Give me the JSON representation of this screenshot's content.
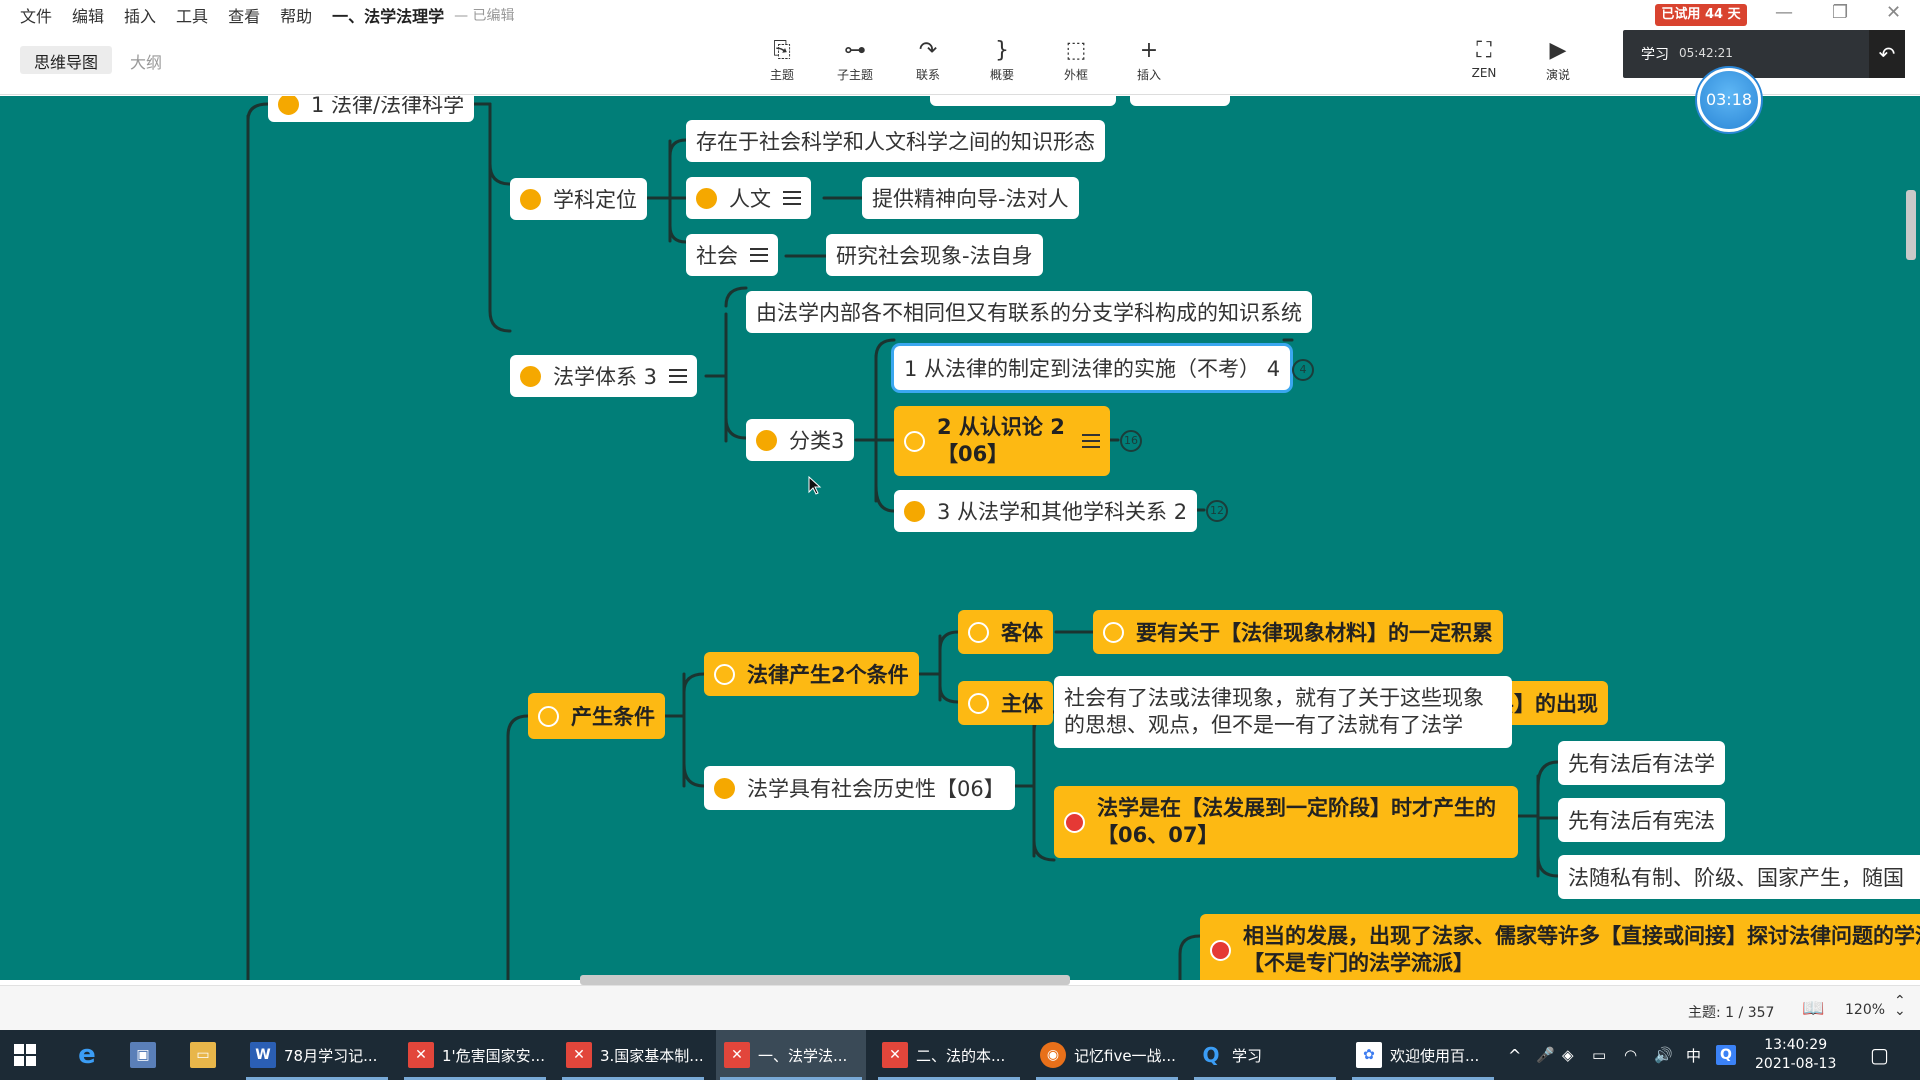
{
  "menubar": {
    "items": [
      "文件",
      "编辑",
      "插入",
      "工具",
      "查看",
      "帮助"
    ],
    "doc_title": "一、法学法理学",
    "doc_status": "— 已编辑",
    "badge": "已试用 44 天"
  },
  "toolbar": {
    "view_tabs": [
      "思维导图",
      "大纲"
    ],
    "tools": [
      {
        "label": "主题",
        "icon": "topic-icon"
      },
      {
        "label": "子主题",
        "icon": "subtopic-icon"
      },
      {
        "label": "联系",
        "icon": "relation-icon"
      },
      {
        "label": "概要",
        "icon": "summary-icon"
      },
      {
        "label": "外框",
        "icon": "boundary-icon"
      },
      {
        "label": "插入",
        "icon": "plus-icon"
      },
      {
        "label": "ZEN",
        "icon": "fullscreen-icon"
      },
      {
        "label": "演说",
        "icon": "present-icon"
      }
    ]
  },
  "timer": {
    "label": "学习",
    "time": "05:42:21",
    "countdown": "03:18"
  },
  "mindmap": {
    "nodes": {
      "n_root": "1 法律/法律科学",
      "n_xkdw": "学科定位",
      "n_zszj": "存在于社会科学和人文科学之间的知识形态",
      "n_renwen": "人文",
      "n_renwen_d": "提供精神向导-法对人",
      "n_shehui": "社会",
      "n_shehui_d": "研究社会现象-法自身",
      "n_fxtx": "法学体系 3",
      "n_fxtx_d": "由法学内部各不相同但又有联系的分支学科构成的知识系统",
      "n_fenlei": "分类3",
      "n_fl1": "1 从法律的制定到法律的实施（不考） 4",
      "n_fl2": "2 从认识论 2 【06】",
      "n_fl3": "3 从法学和其他学科关系 2",
      "n_cstj": "产生条件",
      "n_lvtj": "法律产生2个条件",
      "n_keti": "客体",
      "n_keti_d": "要有关于【法律现象材料】的一定积累",
      "n_zhuti": "主体",
      "n_zhuti_d": "要有专门从事研究法律现象的【学者阶层】的出现",
      "n_shls": "法学具有社会历史性【06】",
      "n_shyl": "社会有了法或法律现象，就有了关于这些现象的思想、观点，但不是一有了法就有了法学",
      "n_fzjd": "法学是在【法发展到一定阶段】时才产生的【06、07】",
      "n_xfhx": "先有法后有法学",
      "n_xfhxf": "先有法后有宪法",
      "n_fsys": "法随私有制、阶级、国家产生，随国",
      "n_xdfz": "相当的发展，出现了法家、儒家等许多【直接或间接】探讨法律问题的学派-【不是专门的法学流派】"
    },
    "badges": {
      "b1": "4",
      "b2": "16",
      "b3": "12"
    }
  },
  "statusbar": {
    "topic_count": "主题: 1 / 357",
    "zoom": "120%"
  },
  "taskbar": {
    "items": [
      {
        "label": "78月学习记...",
        "icon": "word-icon",
        "color": "#2b5fb4"
      },
      {
        "label": "1'危害国家安...",
        "icon": "xmind-icon",
        "color": "#e2463b"
      },
      {
        "label": "3.国家基本制...",
        "icon": "xmind-icon",
        "color": "#e2463b"
      },
      {
        "label": "一、法学法...",
        "icon": "xmind-icon",
        "color": "#e2463b"
      },
      {
        "label": "二、法的本...",
        "icon": "xmind-icon",
        "color": "#e2463b"
      },
      {
        "label": "记忆five一战...",
        "icon": "firefox-icon",
        "color": "#e8701a"
      },
      {
        "label": "学习",
        "icon": "search-app-icon",
        "color": "#2a86d6"
      },
      {
        "label": "欢迎使用百...",
        "icon": "baidu-icon",
        "color": "#3d7cf0"
      }
    ],
    "tray_ime": "中",
    "time": "13:40:29",
    "date": "2021-08-13"
  }
}
